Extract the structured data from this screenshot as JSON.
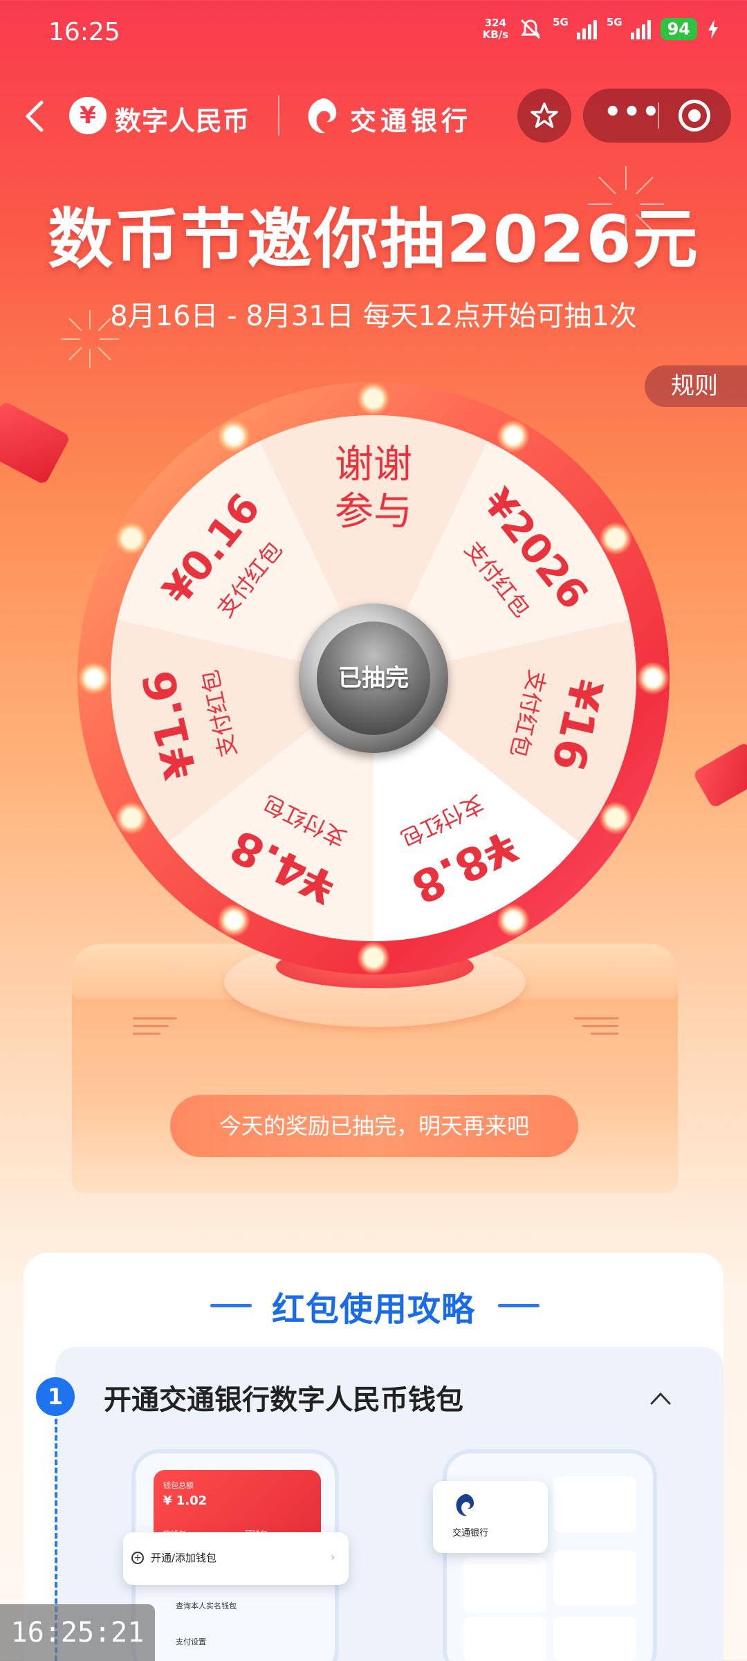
{
  "status_bar": {
    "time": "16:25",
    "net_speed_value": "324",
    "net_speed_unit": "KB/s",
    "signal1_label": "5G",
    "signal2_label": "5G",
    "battery": "94"
  },
  "nav": {
    "ecny_logo_char": "¥",
    "ecny_name": "数字人民币",
    "bank_name": "交通银行"
  },
  "page": {
    "title": "数币节邀你抽2026元",
    "subtitle": "8月16日 - 8月31日 每天12点开始可抽1次",
    "rules": "规则"
  },
  "wheel": {
    "center_label": "已抽完",
    "segments": [
      {
        "amount": "谢谢",
        "desc": "参与",
        "color": "#fde9dc"
      },
      {
        "amount": "¥2026",
        "desc": "支付红包",
        "color": "#fff4ec"
      },
      {
        "amount": "¥16",
        "desc": "支付红包",
        "color": "#fde9dc"
      },
      {
        "amount": "¥8.8",
        "desc": "支付红包",
        "color": "#ffffff"
      },
      {
        "amount": "¥4.8",
        "desc": "支付红包",
        "color": "#fff4ec"
      },
      {
        "amount": "¥1.6",
        "desc": "支付红包",
        "color": "#fde9dc"
      },
      {
        "amount": "¥0.16",
        "desc": "支付红包",
        "color": "#fff4ec"
      }
    ]
  },
  "status_message": "今天的奖励已抽完，明天再来吧",
  "guide": {
    "title": "红包使用攻略",
    "step_number": "1",
    "step_title": "开通交通银行数字人民币钱包"
  },
  "mockup": {
    "wallet_total_label": "钱包总额",
    "wallet_balance": "¥ 1.02",
    "soft_wallet": "软钱包",
    "hard_wallet": "硬钱包",
    "open_wallet": "开通/添加钱包",
    "realname_wallet": "查询本人实名钱包",
    "pay_settings": "支付设置",
    "bank_label": "交通银行"
  },
  "screen_record_time": "16:25:21",
  "colors": {
    "brand_red": "#f0384b",
    "wheel_text": "#e8323d",
    "guide_blue": "#1a6be8"
  }
}
